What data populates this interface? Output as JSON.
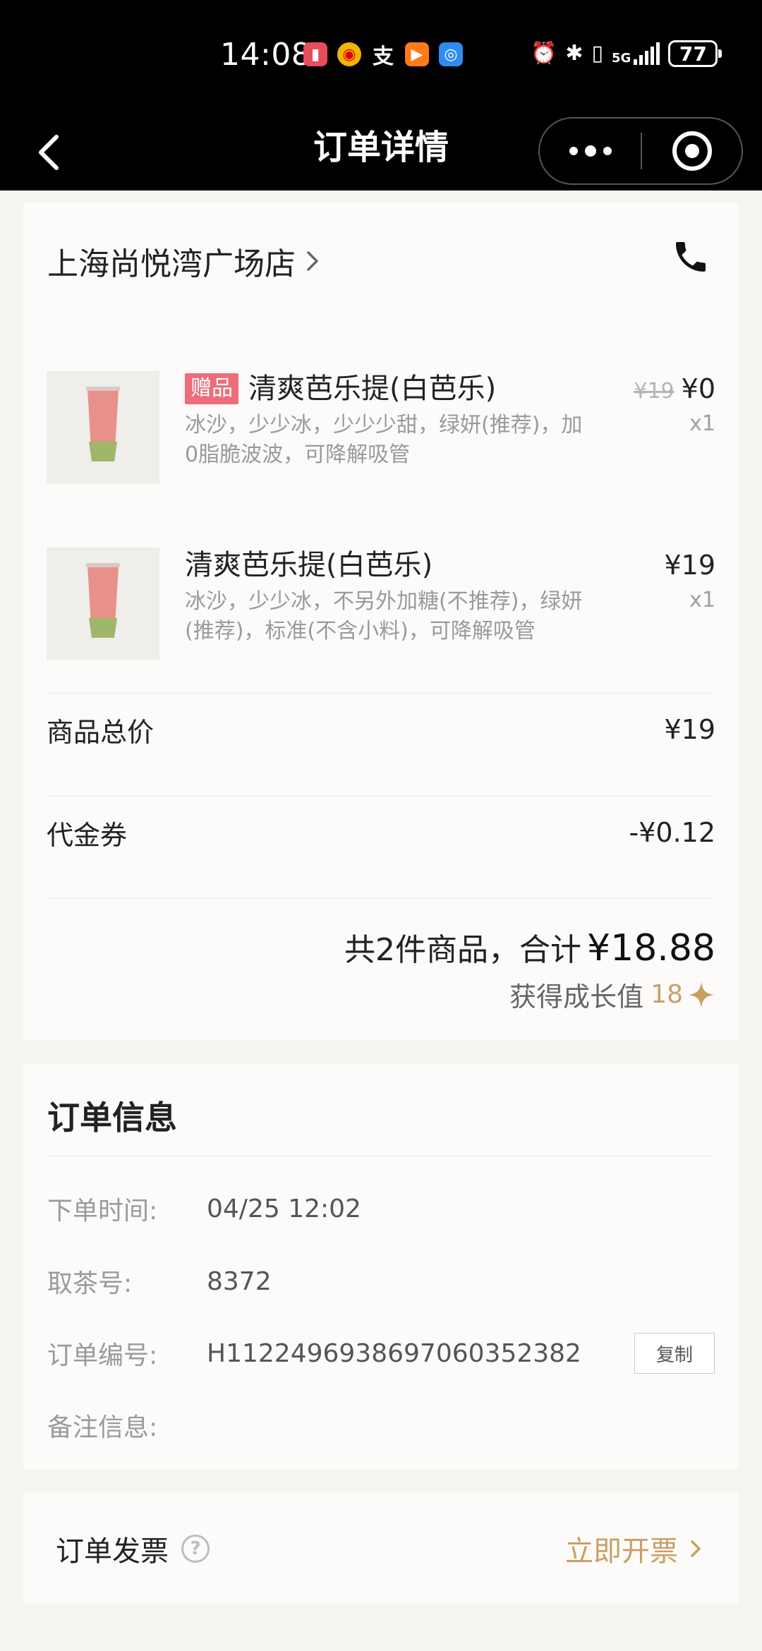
{
  "status_bar": {
    "time": "14:08",
    "notification_icons": [
      "book-app-icon",
      "weibo-icon",
      "alipay-icon",
      "video-app-icon",
      "browser-icon"
    ],
    "system_icons": [
      "alarm-icon",
      "bluetooth-icon",
      "vibrate-icon",
      "signal-5g-icon"
    ],
    "network": "5G",
    "battery": "77"
  },
  "nav": {
    "title": "订单详情"
  },
  "store": {
    "name": "上海尚悦湾广场店"
  },
  "items": [
    {
      "tag": "赠品",
      "name": "清爽芭乐提(白芭乐)",
      "desc": "冰沙，少少冰，少少少甜，绿妍(推荐)，加0脂脆波波，可降解吸管",
      "original_price": "¥19",
      "price": "¥0",
      "qty": "x1"
    },
    {
      "name": "清爽芭乐提(白芭乐)",
      "desc": "冰沙，少少冰，不另外加糖(不推荐)，绿妍(推荐)，标准(不含小料)，可降解吸管",
      "price": "¥19",
      "qty": "x1"
    }
  ],
  "summary": {
    "goods_total_label": "商品总价",
    "goods_total_value": "¥19",
    "coupon_label": "代金券",
    "coupon_value": "-¥0.12",
    "total_text": "共2件商品，合计",
    "total_amount": "¥18.88",
    "growth_label": "获得成长值",
    "growth_value": "18"
  },
  "order_info": {
    "title": "订单信息",
    "order_time_label": "下单时间:",
    "order_time_value": "04/25 12:02",
    "pickup_label": "取茶号:",
    "pickup_value": "8372",
    "order_no_label": "订单编号:",
    "order_no_value": "H1122496938697060352382",
    "copy_label": "复制",
    "note_label": "备注信息:",
    "note_value": ""
  },
  "invoice": {
    "label": "订单发票",
    "help": "?",
    "action": "立即开票"
  },
  "colors": {
    "accent_gold": "#c8a064",
    "gift_tag": "#ee6d7a",
    "background": "#f5f4f1"
  }
}
